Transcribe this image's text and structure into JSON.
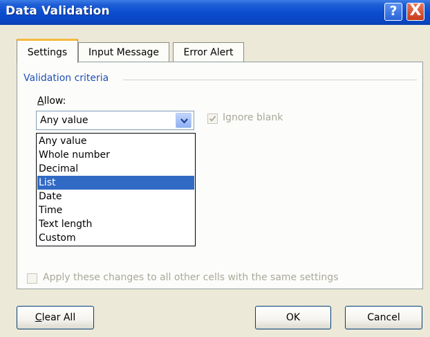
{
  "window": {
    "title": "Data Validation",
    "help_button": "?",
    "close_button": "X"
  },
  "tabs": [
    {
      "label": "Settings",
      "active": true
    },
    {
      "label": "Input Message",
      "active": false
    },
    {
      "label": "Error Alert",
      "active": false
    }
  ],
  "settings": {
    "group_label": "Validation criteria",
    "allow_label": "Allow:",
    "allow_value": "Any value",
    "ignore_blank_label": "Ignore blank",
    "ignore_blank_checked": true,
    "apply_label": "Apply these changes to all other cells with the same settings",
    "apply_checked": false
  },
  "dropdown": {
    "options": [
      "Any value",
      "Whole number",
      "Decimal",
      "List",
      "Date",
      "Time",
      "Text length",
      "Custom"
    ],
    "highlighted": "List"
  },
  "buttons": {
    "clear_all": "Clear All",
    "ok": "OK",
    "cancel": "Cancel"
  },
  "colors": {
    "title_bar": "#0a4dd0",
    "selection": "#316ac5",
    "group_label": "#1f4fb5",
    "active_tab_accent": "#f5b83c"
  }
}
